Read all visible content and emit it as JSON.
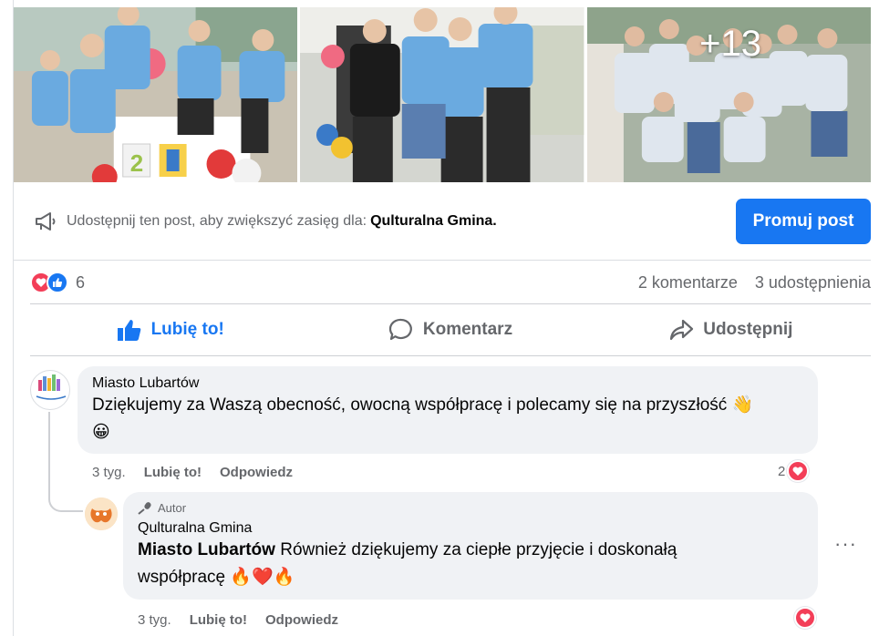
{
  "photos": {
    "more_count": "+13"
  },
  "promote": {
    "icon": "megaphone-icon",
    "text": "Udostępnij ten post, aby zwiększyć zasięg dla:",
    "page_name": "Qulturalna Gmina.",
    "button_label": "Promuj post",
    "button_color": "#1877f2"
  },
  "stats": {
    "reaction_count": "6",
    "comments": "2 komentarze",
    "shares": "3 udostępnienia"
  },
  "actions": {
    "like": "Lubię to!",
    "comment": "Komentarz",
    "share": "Udostępnij"
  },
  "comments": [
    {
      "author": "Miasto Lubartów",
      "text": "Dziękujemy za Waszą obecność, owocną współpracę i polecamy się na przyszłość 👋",
      "text_line2": "😀",
      "time": "3 tyg.",
      "like": "Lubię to!",
      "reply": "Odpowiedz",
      "reaction_count": "2"
    },
    {
      "badge": "Autor",
      "author": "Qulturalna Gmina",
      "mention": "Miasto Lubartów",
      "text": " Również dziękujemy za ciepłe przyjęcie i doskonałą",
      "text_line2": "współpracę 🔥❤️🔥",
      "time": "3 tyg.",
      "like": "Lubię to!",
      "reply": "Odpowiedz",
      "more": "···"
    }
  ],
  "colors": {
    "accent": "#1877f2",
    "love": "#f33e58",
    "muted": "#65676b",
    "bubble": "#f0f2f5"
  }
}
